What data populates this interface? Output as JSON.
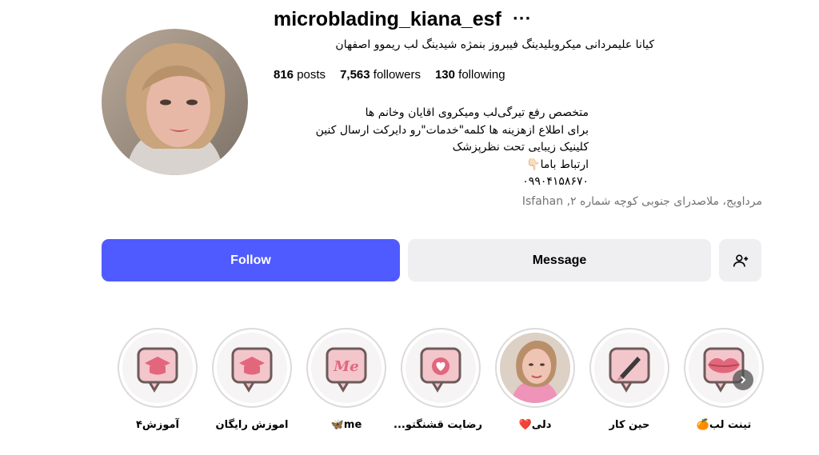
{
  "profile": {
    "username": "microblading_kiana_esf",
    "more_icon": "ellipsis-icon",
    "full_name": "کیانا علیمردانی میکروبلیدینگ فیبروز بنمژه شیدینگ لب ریموو اصفهان",
    "stats": {
      "posts_count": "816",
      "posts_label": "posts",
      "followers_count": "7,563",
      "followers_label": "followers",
      "following_count": "130",
      "following_label": "following"
    },
    "bio_lines": [
      "متخصص رفع تیرگی‌لب ومیکروی اقایان وخانم ها",
      "برای اطلاع ازهزینه ها کلمه\"خدمات\"رو دایرکت ارسال کنین",
      "کلینیک زیبایی تحت نظرپزشک",
      "ارتباط باما👇🏻",
      "۰۹۹۰۴۱۵۸۶۷۰"
    ],
    "location": "مرداویج، ملاصدرای جنوبی کوچه شماره ۲, Isfahan"
  },
  "actions": {
    "follow_label": "Follow",
    "message_label": "Message",
    "add_user_icon": "person-plus-icon",
    "follow_color": "#4f5bff",
    "secondary_color": "#efeff1"
  },
  "highlights": [
    {
      "label": "آموزش۴",
      "icon": "graduation-cap-icon"
    },
    {
      "label": "اموزش رایگان",
      "icon": "graduation-cap-icon"
    },
    {
      "label": "me🦋",
      "icon": "me-bubble-icon"
    },
    {
      "label": "رضایت قشنگتو...",
      "icon": "heart-bubble-icon"
    },
    {
      "label": "دلی❤️",
      "icon": "photo-portrait"
    },
    {
      "label": "حین کار",
      "icon": "pen-icon"
    },
    {
      "label": "تینت لب🍊",
      "icon": "lips-icon"
    }
  ],
  "highlights_next_icon": "chevron-right-icon"
}
